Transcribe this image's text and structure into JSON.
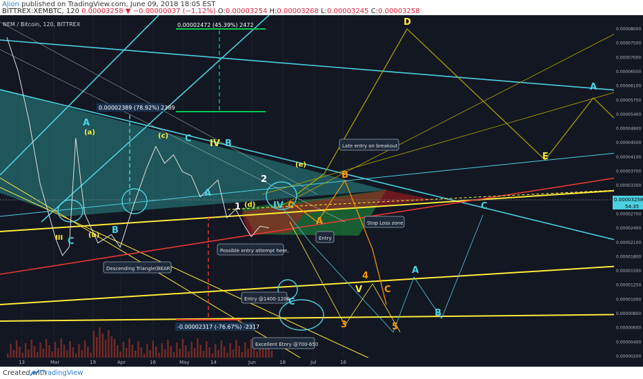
{
  "header": {
    "author": "Ajion",
    "published": "published on TradingView.com, June 09, 2018 18:05 EST",
    "symbol_line": "BITTREX:XEMBTC, 120",
    "last": "0.00003258",
    "change": "−0.00000037 (−1.12%)",
    "o_label": "O:",
    "o_val": "0.00003254",
    "h_label": "H:",
    "h_val": "0.00003268",
    "l_label": "L:",
    "l_val": "0.00003245",
    "c_label": "C:",
    "c_val": "0.00003258"
  },
  "footer": {
    "created_with": "Created with",
    "brand": "TradingView"
  },
  "chart_data": {
    "type": "line",
    "title": "NEM / Bitcoin, 120, BITTREX",
    "x_ticks": [
      "13",
      "Mar",
      "19",
      "Apr",
      "16",
      "May",
      "14",
      "Jun",
      "18",
      "Jul",
      "16"
    ],
    "y_ticks": [
      "0.00008000",
      "0.00007500",
      "0.00007000",
      "0.00006500",
      "0.00006100",
      "0.00005750",
      "0.00005400",
      "0.00004900",
      "0.00004500",
      "0.00004100",
      "0.00003700",
      "0.00003300",
      "0.00003000",
      "0.00002700",
      "0.00002400",
      "0.00002100",
      "0.00001800",
      "0.00001500",
      "0.00001250",
      "0.00001000",
      "0.00000800",
      "0.00000600",
      "0.00000400",
      "0.00000200"
    ],
    "last_price_label": "0.00003258",
    "countdown": "54:35",
    "price": {
      "x": [
        "Feb 11",
        "Feb 16",
        "Feb 21",
        "Feb 26",
        "Mar 3",
        "Mar 6",
        "Mar 9",
        "Mar 12",
        "Mar 16",
        "Mar 22",
        "Mar 28",
        "Apr 2",
        "Apr 8",
        "Apr 14",
        "Apr 18",
        "Apr 22",
        "Apr 26",
        "Apr 30",
        "May 4",
        "May 8",
        "May 12",
        "May 16",
        "May 20",
        "May 24",
        "May 28",
        "Jun 1",
        "Jun 5",
        "Jun 9"
      ],
      "y": [
        7.8e-05,
        7e-05,
        5.8e-05,
        4.3e-05,
        3e-05,
        2.6e-05,
        2.8e-05,
        5.4e-05,
        3.6e-05,
        2.9e-05,
        3.1e-05,
        2.8e-05,
        3.8e-05,
        4.7e-05,
        5.2e-05,
        4.8e-05,
        5e-05,
        4.6e-05,
        4.5e-05,
        4e-05,
        4.2e-05,
        4.4e-05,
        3.5e-05,
        3.7e-05,
        3.3e-05,
        3.05e-05,
        3.3e-05,
        3.26e-05
      ]
    },
    "measurements": [
      {
        "text": "0.00002472 (45.39%) 2472"
      },
      {
        "text": "0.00002389 (78.92%) 2389"
      },
      {
        "text": "-0.00002317 (-76.67%) -2317"
      }
    ],
    "wave_labels": [
      {
        "text": "III",
        "color": "#ffeb3b"
      },
      {
        "text": "C",
        "color": "#4dd0e1"
      },
      {
        "text": "(b)",
        "color": "#ffeb3b"
      },
      {
        "text": "B",
        "color": "#4dd0e1"
      },
      {
        "text": "A",
        "color": "#4dd0e1"
      },
      {
        "text": "(a)",
        "color": "#ffeb3b"
      },
      {
        "text": "(c)",
        "color": "#ffeb3b"
      },
      {
        "text": "C",
        "color": "#4dd0e1"
      },
      {
        "text": "IV",
        "color": "#ffeb3b"
      },
      {
        "text": "B",
        "color": "#4dd0e1"
      },
      {
        "text": "A",
        "color": "#4dd0e1"
      },
      {
        "text": "2",
        "color": "#ffffff"
      },
      {
        "text": "1",
        "color": "#ffffff"
      },
      {
        "text": "(d)",
        "color": "#ffeb3b"
      },
      {
        "text": "IV",
        "color": "#4dd0e1"
      },
      {
        "text": "C",
        "color": "#ff9800"
      },
      {
        "text": "(e)",
        "color": "#ffeb3b"
      },
      {
        "text": "B",
        "color": "#ff9800"
      },
      {
        "text": "A",
        "color": "#ff9800"
      },
      {
        "text": "C",
        "color": "#4dd0e1"
      },
      {
        "text": "D",
        "color": "#ffeb3b"
      },
      {
        "text": "E",
        "color": "#ffeb3b"
      },
      {
        "text": "A",
        "color": "#4dd0e1"
      },
      {
        "text": "C",
        "color": "#4dd0e1"
      },
      {
        "text": "4",
        "color": "#ff9800"
      },
      {
        "text": "V",
        "color": "#ffeb3b"
      },
      {
        "text": "C",
        "color": "#ff9800"
      },
      {
        "text": "A",
        "color": "#4dd0e1"
      },
      {
        "text": "B",
        "color": "#4dd0e1"
      },
      {
        "text": "3",
        "color": "#ff9800"
      },
      {
        "text": "5",
        "color": "#ff9800"
      }
    ],
    "annotations": [
      {
        "text": "Late entry on breakout"
      },
      {
        "text": "Stop Loss zone"
      },
      {
        "text": "Entry"
      },
      {
        "text": "Possible entry attempt here,"
      },
      {
        "text": "Descending Triangle(BEAR)"
      },
      {
        "text": "Entry @1400-1200"
      },
      {
        "text": "Excellent Etnry @700-650"
      }
    ],
    "colors": {
      "background": "#131722",
      "triangle_fill": "#2a8a8a",
      "cyan": "#4dd0e1",
      "yellow": "#ffeb3b",
      "orange": "#ff9800",
      "green": "#00c853",
      "red": "#e53935"
    }
  }
}
